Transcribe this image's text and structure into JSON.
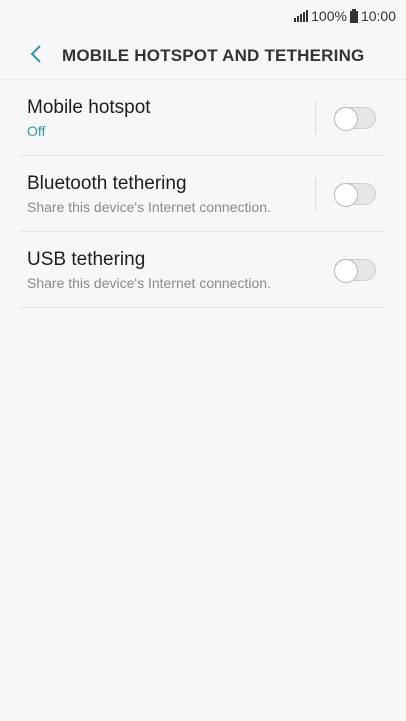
{
  "status_bar": {
    "battery": "100%",
    "time": "10:00",
    "icons": [
      "signal-icon",
      "battery-icon"
    ]
  },
  "header": {
    "title": "MOBILE HOTSPOT AND TETHERING",
    "back_icon": "chevron-left-icon"
  },
  "colors": {
    "accent": "#2a9ab0",
    "background": "#f7f7f7"
  },
  "settings": [
    {
      "title": "Mobile hotspot",
      "subtitle": "Off",
      "enabled": false
    },
    {
      "title": "Bluetooth tethering",
      "subtitle": "Share this device's Internet connection.",
      "enabled": false
    },
    {
      "title": "USB tethering",
      "subtitle": "Share this device's Internet connection.",
      "enabled": false
    }
  ]
}
